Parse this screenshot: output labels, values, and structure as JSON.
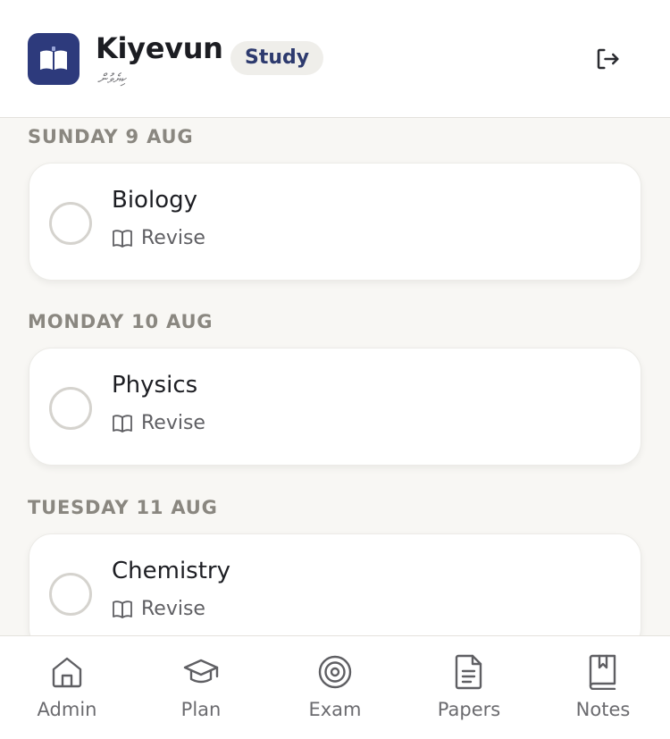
{
  "header": {
    "title": "Kiyevun",
    "subtitle": "ކިޔެވުން",
    "badge": "Study"
  },
  "schedule": [
    {
      "day": "SUNDAY 9 AUG",
      "subject": "Biology",
      "task": "Revise",
      "done": false
    },
    {
      "day": "MONDAY 10 AUG",
      "subject": "Physics",
      "task": "Revise",
      "done": false
    },
    {
      "day": "TUESDAY 11 AUG",
      "subject": "Chemistry",
      "task": "Revise",
      "done": false
    }
  ],
  "nav": [
    {
      "label": "Admin",
      "icon": "home-icon"
    },
    {
      "label": "Plan",
      "icon": "graduation-cap-icon"
    },
    {
      "label": "Exam",
      "icon": "target-icon"
    },
    {
      "label": "Papers",
      "icon": "document-icon"
    },
    {
      "label": "Notes",
      "icon": "bookmark-book-icon"
    }
  ],
  "colors": {
    "brand": "#2d3a7c",
    "background": "#f8f7f4",
    "muted_text": "#8a8780",
    "icon": "#5f5f63"
  }
}
